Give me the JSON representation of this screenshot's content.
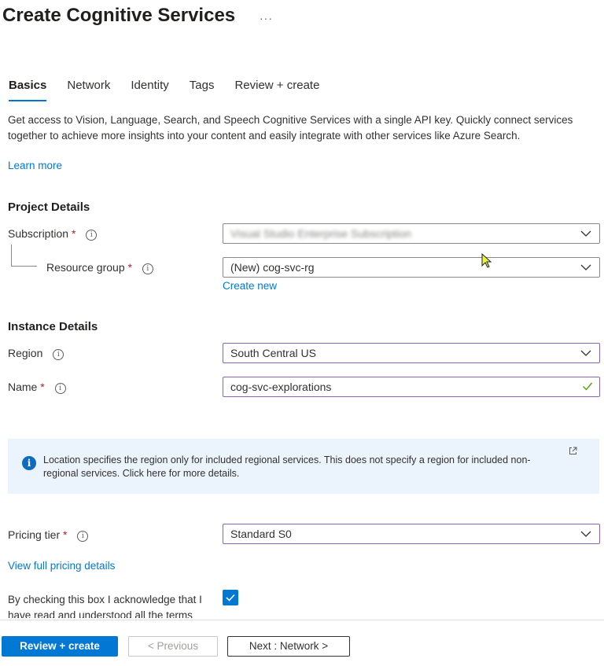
{
  "page": {
    "title": "Create Cognitive Services",
    "more": "···"
  },
  "tabs": [
    {
      "label": "Basics",
      "active": true
    },
    {
      "label": "Network",
      "active": false
    },
    {
      "label": "Identity",
      "active": false
    },
    {
      "label": "Tags",
      "active": false
    },
    {
      "label": "Review + create",
      "active": false
    }
  ],
  "description": "Get access to Vision, Language, Search, and Speech Cognitive Services with a single API key. Quickly connect services together to achieve more insights into your content and easily integrate with other services like Azure Search.",
  "learn_more": "Learn more",
  "project": {
    "heading": "Project Details",
    "subscription": {
      "label": "Subscription",
      "required": "*",
      "value": "Visual Studio Enterprise Subscription"
    },
    "resource_group": {
      "label": "Resource group",
      "required": "*",
      "value": "(New) cog-svc-rg"
    },
    "create_new": "Create new"
  },
  "instance": {
    "heading": "Instance Details",
    "region": {
      "label": "Region",
      "value": "South Central US"
    },
    "name": {
      "label": "Name",
      "required": "*",
      "value": "cog-svc-explorations"
    }
  },
  "info_box": {
    "text": "Location specifies the region only for included regional services. This does not specify a region for included non-regional services. Click here for more details."
  },
  "pricing": {
    "label": "Pricing tier",
    "required": "*",
    "value": "Standard S0",
    "link": "View full pricing details"
  },
  "acknowledge": {
    "text": "By checking this box I acknowledge that I have read and understood all the terms",
    "checked": true
  },
  "footer": {
    "review_create": "Review + create",
    "previous": "< Previous",
    "next": "Next : Network >"
  },
  "icons": {
    "info": "info-circle-icon",
    "chevron": "chevron-down-icon",
    "check": "checkmark-icon",
    "external": "external-link-icon",
    "cursor": "mouse-pointer-icon"
  },
  "colors": {
    "accent": "#0078d4",
    "focus_border": "#8764b8",
    "required": "#a4262c",
    "valid": "#57a300",
    "info_bg": "#ebf3fc"
  }
}
